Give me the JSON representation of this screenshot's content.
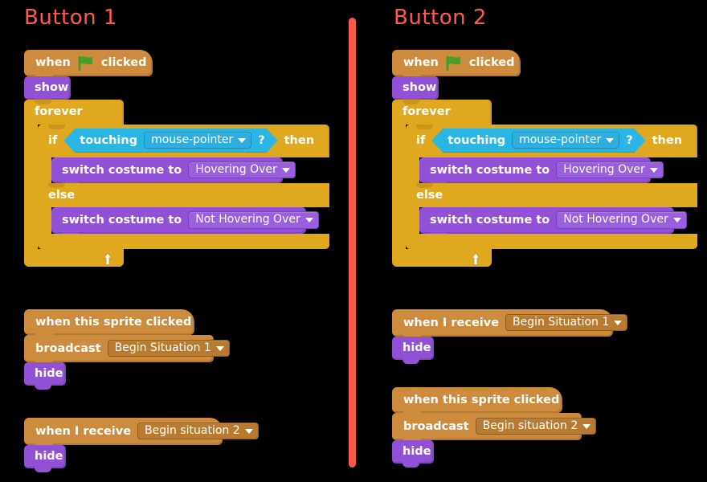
{
  "page": {
    "background": "#000000",
    "divider_color": "#fc5a4b",
    "title_color": "#ff5a4d"
  },
  "colors": {
    "events_brown": "#cd8c3d",
    "looks_purple": "#9150d6",
    "control_gold": "#e0a81f",
    "sensing_blue": "#29b6e5"
  },
  "columns": [
    {
      "title": "Button 1",
      "scripts": [
        {
          "id": "script-main-1",
          "blocks": {
            "hat": {
              "when": "when",
              "flag_icon": "green-flag-icon",
              "clicked": "clicked"
            },
            "show": "show",
            "forever": "forever",
            "if": "if",
            "touching": "touching",
            "touching_target": "mouse-pointer",
            "question": "?",
            "then": "then",
            "switch_a_label": "switch  costume  to",
            "switch_a_value": "Hovering Over",
            "else": "else",
            "switch_b_label": "switch  costume  to",
            "switch_b_value": "Not Hovering Over"
          }
        },
        {
          "id": "script-sprite-clicked-1",
          "blocks": {
            "hat": "when  this  sprite  clicked",
            "broadcast_label": "broadcast",
            "broadcast_value": "Begin Situation 1",
            "hide": "hide"
          }
        },
        {
          "id": "script-receive-1",
          "blocks": {
            "hat_label": "when  I  receive",
            "hat_value": "Begin situation 2",
            "hide": "hide"
          }
        }
      ]
    },
    {
      "title": "Button 2",
      "scripts": [
        {
          "id": "script-main-2",
          "blocks": {
            "hat": {
              "when": "when",
              "flag_icon": "green-flag-icon",
              "clicked": "clicked"
            },
            "show": "show",
            "forever": "forever",
            "if": "if",
            "touching": "touching",
            "touching_target": "mouse-pointer",
            "question": "?",
            "then": "then",
            "switch_a_label": "switch  costume  to",
            "switch_a_value": "Hovering Over",
            "else": "else",
            "switch_b_label": "switch  costume  to",
            "switch_b_value": "Not Hovering Over"
          }
        },
        {
          "id": "script-receive-2",
          "blocks": {
            "hat_label": "when  I  receive",
            "hat_value": "Begin Situation 1",
            "hide": "hide"
          }
        },
        {
          "id": "script-sprite-clicked-2",
          "blocks": {
            "hat": "when  this  sprite  clicked",
            "broadcast_label": "broadcast",
            "broadcast_value": "Begin situation 2",
            "hide": "hide"
          }
        }
      ]
    }
  ]
}
